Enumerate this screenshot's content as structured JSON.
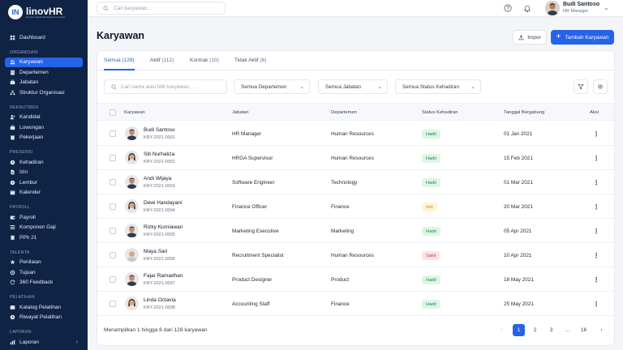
{
  "brand": {
    "name": "linovHR",
    "tagline": "Human Capital Management System",
    "mark": "IN"
  },
  "search": {
    "placeholder": "Cari karyawan..."
  },
  "user": {
    "name": "Budi Santoso",
    "role": "HR Manager"
  },
  "sidebar": {
    "dashboard": {
      "label": "Dashboard",
      "icon": "dashboard-icon"
    },
    "sections": [
      {
        "title": "ORGANISASI",
        "items": [
          {
            "label": "Karyawan",
            "icon": "users-icon",
            "active": true
          },
          {
            "label": "Departemen",
            "icon": "building-icon"
          },
          {
            "label": "Jabatan",
            "icon": "briefcase-icon"
          },
          {
            "label": "Struktur Organisasi",
            "icon": "hierarchy-icon"
          }
        ]
      },
      {
        "title": "REKRUTMEN",
        "items": [
          {
            "label": "Kandidat",
            "icon": "user-plus-icon"
          },
          {
            "label": "Lowongan",
            "icon": "briefcase-icon"
          },
          {
            "label": "Pekerjaan",
            "icon": "clipboard-icon"
          }
        ]
      },
      {
        "title": "PRESENSI",
        "items": [
          {
            "label": "Kehadiran",
            "icon": "clock-icon"
          },
          {
            "label": "Izin",
            "icon": "document-icon"
          },
          {
            "label": "Lembur",
            "icon": "clock-icon"
          },
          {
            "label": "Kalender",
            "icon": "calendar-icon"
          }
        ]
      },
      {
        "title": "PAYROLL",
        "items": [
          {
            "label": "Payroll",
            "icon": "wallet-icon"
          },
          {
            "label": "Komponen Gaji",
            "icon": "list-icon"
          },
          {
            "label": "PPh 21",
            "icon": "receipt-icon"
          }
        ]
      },
      {
        "title": "TALENTA",
        "items": [
          {
            "label": "Penilaian",
            "icon": "star-icon"
          },
          {
            "label": "Tujuan",
            "icon": "target-icon"
          },
          {
            "label": "360 Feedback",
            "icon": "refresh-icon"
          }
        ]
      },
      {
        "title": "PELATIHAN",
        "items": [
          {
            "label": "Katalog Pelatihan",
            "icon": "book-icon"
          },
          {
            "label": "Riwayat Pelatihan",
            "icon": "history-icon"
          }
        ]
      },
      {
        "title": "LAPORAN",
        "items": [
          {
            "label": "Laporan",
            "icon": "chart-icon",
            "chevron": "›"
          }
        ]
      }
    ]
  },
  "page": {
    "title": "Karyawan",
    "import_label": "Impor",
    "add_label": "Tambah Karyawan"
  },
  "tabs": [
    {
      "label": "Semua",
      "count": "(128)"
    },
    {
      "label": "Aktif",
      "count": "(112)"
    },
    {
      "label": "Kontrak",
      "count": "(10)"
    },
    {
      "label": "Tidak Aktif",
      "count": "(6)"
    }
  ],
  "filters": {
    "search_placeholder": "Cari nama atau NIK karyawan...",
    "department": "Semua Departemen",
    "position": "Semua Jabatan",
    "status": "Semua Status Kehadiran"
  },
  "table": {
    "headers": [
      "Karyawan",
      "Jabatan",
      "Departemen",
      "Status Kehadiran",
      "Tanggal Bergabung",
      "Aksi"
    ],
    "rows": [
      {
        "name": "Budi Santoso",
        "id": "KRY-2021-0001",
        "position": "HR Manager",
        "department": "Human Resources",
        "status": "Hadir",
        "status_type": "hadir",
        "joined": "01 Jan 2021",
        "gender": "m"
      },
      {
        "name": "Siti Nurhaliza",
        "id": "KRY-2021-0002",
        "position": "HRGA Supervisor",
        "department": "Human Resources",
        "status": "Hadir",
        "status_type": "hadir",
        "joined": "15 Feb 2021",
        "gender": "f"
      },
      {
        "name": "Andi Wijaya",
        "id": "KRY-2021-0003",
        "position": "Software Engineer",
        "department": "Technology",
        "status": "Hadir",
        "status_type": "hadir",
        "joined": "01 Mar 2021",
        "gender": "m"
      },
      {
        "name": "Dewi Handayani",
        "id": "KRY-2021-0004",
        "position": "Finance Officer",
        "department": "Finance",
        "status": "Izin",
        "status_type": "izin",
        "joined": "20 Mar 2021",
        "gender": "f"
      },
      {
        "name": "Rizky Kurniawan",
        "id": "KRY-2021-0005",
        "position": "Marketing Executive",
        "department": "Marketing",
        "status": "Hadir",
        "status_type": "hadir",
        "joined": "05 Apr 2021",
        "gender": "m"
      },
      {
        "name": "Maya Sari",
        "id": "KRY-2021-0006",
        "position": "Recruitment Specialist",
        "department": "Human Resources",
        "status": "Sakit",
        "status_type": "sakit",
        "joined": "10 Apr 2021",
        "gender": "h"
      },
      {
        "name": "Fajar Ramadhan",
        "id": "KRY-2021-0007",
        "position": "Product Designer",
        "department": "Product",
        "status": "Hadir",
        "status_type": "hadir",
        "joined": "18 May 2021",
        "gender": "m"
      },
      {
        "name": "Linda Octavia",
        "id": "KRY-2021-0008",
        "position": "Accounting Staff",
        "department": "Finance",
        "status": "Hadir",
        "status_type": "hadir",
        "joined": "25 May 2021",
        "gender": "f"
      }
    ]
  },
  "footer": {
    "summary": "Menampilkan 1 hingga 8 dari 128 karyawan"
  },
  "pagination": {
    "prev": "‹",
    "pages": [
      "1",
      "2",
      "3",
      "...",
      "16"
    ],
    "current": "1",
    "next": "›"
  }
}
